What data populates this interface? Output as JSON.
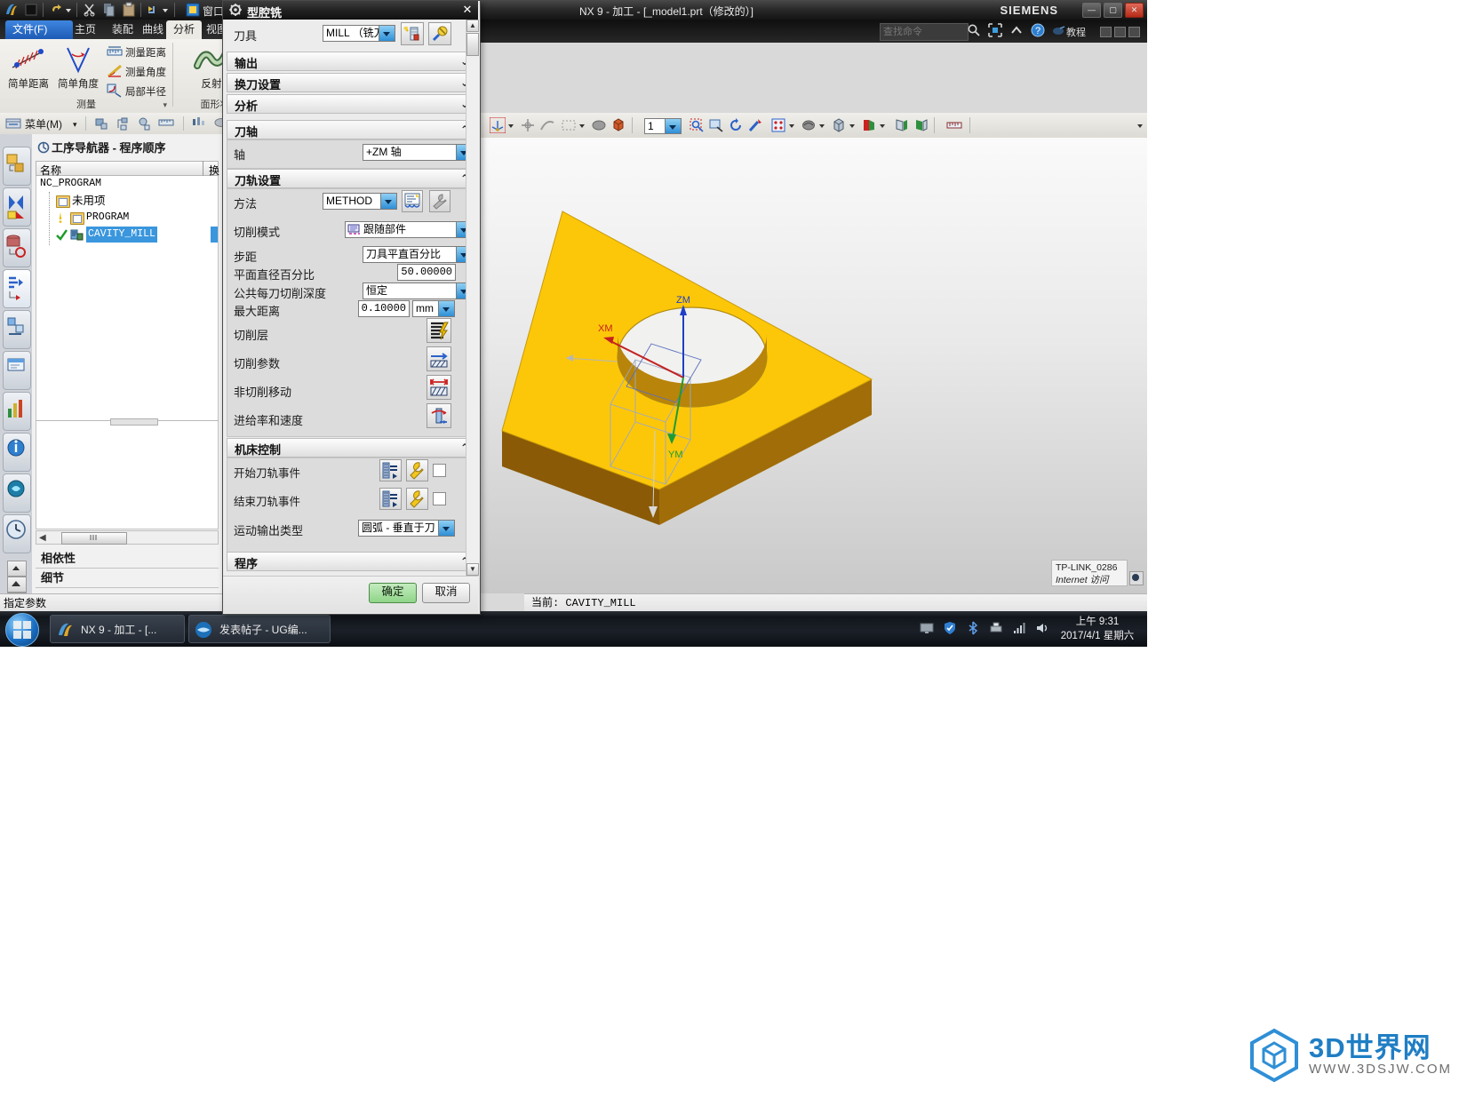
{
  "window": {
    "title": "NX 9 - 加工 - [_model1.prt（修改的）]",
    "brand": "SIEMENS",
    "min": "—",
    "max": "▢",
    "close": "✕"
  },
  "bar2": {
    "search_placeholder": "查找命令",
    "tutorial_label": "教程",
    "icons": [
      "search-icon",
      "fullscreen-icon",
      "chevron-up-icon",
      "help-icon",
      "mouse-icon"
    ]
  },
  "ribbon": {
    "tabs": [
      {
        "label": "文件(F)",
        "kind": "file"
      },
      {
        "label": "主页",
        "kind": "normal"
      },
      {
        "label": "装配",
        "kind": "normal"
      },
      {
        "label": "曲线",
        "kind": "normal"
      },
      {
        "label": "分析",
        "kind": "active"
      },
      {
        "label": "视图",
        "kind": "normal"
      }
    ],
    "groups": [
      {
        "name": "测量",
        "big": [
          {
            "label": "简单距离",
            "icon": "simple-distance-icon"
          },
          {
            "label": "简单角度",
            "icon": "simple-angle-icon"
          }
        ],
        "small": [
          {
            "label": "测量距离",
            "icon": "measure-distance-icon"
          },
          {
            "label": "测量角度",
            "icon": "measure-angle-icon"
          },
          {
            "label": "局部半径",
            "icon": "local-radius-icon"
          }
        ]
      },
      {
        "name": "面形状",
        "big": [
          {
            "label": "反射",
            "icon": "reflection-icon"
          }
        ],
        "small": []
      }
    ]
  },
  "menustrip": {
    "menu_label": "菜单(M)",
    "icons": [
      "object-icon",
      "feature-icon",
      "point-icon",
      "ruler-icon",
      "histogram-icon",
      "cloud-icon"
    ]
  },
  "navigator": {
    "title": "工序导航器 - 程序顺序",
    "columns": [
      "名称",
      "换刀"
    ],
    "rows": [
      {
        "label": "NC_PROGRAM",
        "indent": 0,
        "mono": true,
        "selected": false,
        "mark": "",
        "icon": ""
      },
      {
        "label": "未用项",
        "indent": 1,
        "mono": false,
        "selected": false,
        "mark": "",
        "icon": "folder-icon"
      },
      {
        "label": "PROGRAM",
        "indent": 2,
        "mono": true,
        "selected": false,
        "mark": "warning-icon",
        "icon": "folder-icon"
      },
      {
        "label": "CAVITY_MILL",
        "indent": 2,
        "mono": true,
        "selected": true,
        "mark": "check-icon",
        "icon": "operation-icon"
      }
    ],
    "panels": [
      {
        "label": "相依性"
      },
      {
        "label": "细节"
      }
    ]
  },
  "status": {
    "left": "指定参数",
    "right": "当前: CAVITY_MILL"
  },
  "graphics": {
    "toolbar_icons": [
      "datum-csys-icon",
      "point-icon",
      "edge-icon",
      "rect-select-icon",
      "shaded-icon",
      "solid-icon",
      "layer-number",
      "zoom-fit-icon",
      "zoom-window-icon",
      "rotate-icon",
      "pan-icon",
      "render-style-icon",
      "shade-icon",
      "solid-view-icon",
      "section-icon",
      "clip-front-icon",
      "clip-back-icon",
      "measure-icon"
    ],
    "layer_value": "1",
    "axes": [
      {
        "label": "ZM",
        "color": "#2a49c0"
      },
      {
        "label": "XM",
        "color": "#c02020"
      },
      {
        "label": "YM",
        "color": "#1f9d3a"
      }
    ]
  },
  "toast": {
    "ssid": "TP-LINK_0286",
    "state": "Internet 访问"
  },
  "dialog": {
    "title": "型腔铣",
    "title_icon": "gear-icon",
    "close": "✕",
    "tool": {
      "label": "刀具",
      "value": "MILL （铣刀-",
      "btn_new_icon": "new-tool-icon",
      "btn_edit_icon": "edit-tool-icon"
    },
    "collapsed_sections": [
      {
        "label": "输出"
      },
      {
        "label": "换刀设置"
      },
      {
        "label": "分析"
      }
    ],
    "tool_axis": {
      "header": "刀轴",
      "axis_label": "轴",
      "axis_value": "+ZM 轴"
    },
    "path_settings": {
      "header": "刀轨设置",
      "method_label": "方法",
      "method_value": "METHOD",
      "method_btn1_icon": "method-edit-icon",
      "method_btn2_icon": "wrench-icon",
      "cut_mode_label": "切削模式",
      "cut_mode_value": "跟随部件",
      "stepover_label": "步距",
      "stepover_value": "刀具平直百分比",
      "flat_dia_label": "平面直径百分比",
      "flat_dia_value": "50.00000",
      "depth_label": "公共每刀切削深度",
      "depth_value": "恒定",
      "max_dist_label": "最大距离",
      "max_dist_value": "0.10000",
      "max_dist_unit": "mm",
      "buttons": [
        {
          "label": "切削层",
          "icon": "cut-levels-icon"
        },
        {
          "label": "切削参数",
          "icon": "cut-parameters-icon"
        },
        {
          "label": "非切削移动",
          "icon": "non-cutting-moves-icon"
        },
        {
          "label": "进给率和速度",
          "icon": "feeds-speeds-icon"
        }
      ]
    },
    "machine_control": {
      "header": "机床控制",
      "rows": [
        {
          "label": "开始刀轨事件",
          "icon1": "event-list-icon",
          "icon2": "wrench-icon",
          "checkbox": false
        },
        {
          "label": "结束刀轨事件",
          "icon1": "event-list-icon",
          "icon2": "wrench-icon",
          "checkbox": false
        }
      ],
      "motion_label": "运动输出类型",
      "motion_value": "圆弧 - 垂直于刀"
    },
    "program_section": {
      "header": "程序"
    },
    "chevrons": "^ ^ ^",
    "ok_label": "确定",
    "cancel_label": "取消"
  },
  "taskbar": {
    "items": [
      {
        "label": "NX 9 - 加工 - [...",
        "icon": "nx-icon"
      },
      {
        "label": "发表帖子 - UG编...",
        "icon": "browser-icon"
      }
    ],
    "tray_icons": [
      "monitor-icon",
      "shield-icon",
      "bluetooth-icon",
      "printer-icon",
      "network-icon",
      "volume-icon"
    ],
    "time": "上午 9:31",
    "date": "2017/4/1 星期六"
  },
  "watermark": {
    "logo": "cube-logo-icon",
    "title": "3D世界网",
    "url": "WWW.3DSJW.COM"
  }
}
